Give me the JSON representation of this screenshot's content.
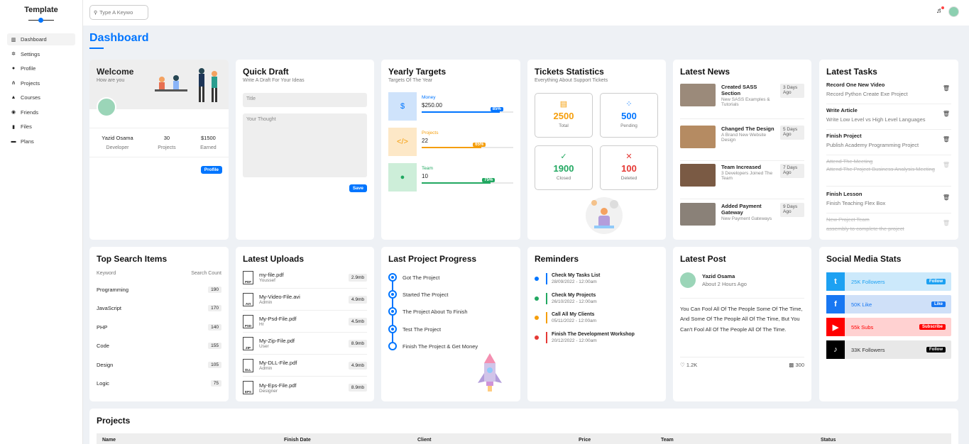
{
  "app": {
    "title": "Template"
  },
  "search": {
    "placeholder": "Type A Keywo"
  },
  "nav": [
    {
      "label": "Dashboard",
      "icon": "chart-icon"
    },
    {
      "label": "Settings",
      "icon": "gear-icon"
    },
    {
      "label": "Profile",
      "icon": "user-icon"
    },
    {
      "label": "Projects",
      "icon": "diagram-icon"
    },
    {
      "label": "Courses",
      "icon": "graduation-cap-icon"
    },
    {
      "label": "Friends",
      "icon": "user-circle-icon"
    },
    {
      "label": "Files",
      "icon": "file-icon"
    },
    {
      "label": "Plans",
      "icon": "credit-card-icon"
    }
  ],
  "page_title": "Dashboard",
  "welcome": {
    "title": "Welcome",
    "subtitle": "How are you",
    "name": "Yazid Osama",
    "role": "Developer",
    "projects_value": "30",
    "projects_label": "Projects",
    "earned_value": "$1500",
    "earned_label": "Earned",
    "button": "Profile"
  },
  "draft": {
    "title": "Quick Draft",
    "subtitle": "Write A Draft For Your Ideas",
    "title_placeholder": "Title",
    "body_placeholder": "Your Thought",
    "button": "Save"
  },
  "targets": {
    "title": "Yearly Targets",
    "subtitle": "Targets Of The Year",
    "items": [
      {
        "label": "Money",
        "value": "$250.00",
        "percent": "85%",
        "color": "#0075ff",
        "bg": "#cfe3fb",
        "glyph": "$"
      },
      {
        "label": "Projects",
        "value": "22",
        "percent": "65%",
        "color": "#f59e0b",
        "bg": "#fde8c7",
        "glyph": "</>"
      },
      {
        "label": "Team",
        "value": "10",
        "percent": "75%",
        "color": "#22a861",
        "bg": "#cdeed9",
        "glyph": "●"
      }
    ]
  },
  "tickets": {
    "title": "Tickets Statistics",
    "subtitle": "Everything About Support Tickets",
    "items": [
      {
        "value": "2500",
        "label": "Total",
        "color": "#f59e0b",
        "glyph": "▤"
      },
      {
        "value": "500",
        "label": "Pending",
        "color": "#0075ff",
        "glyph": "⁘"
      },
      {
        "value": "1900",
        "label": "Closed",
        "color": "#22a861",
        "glyph": "✓"
      },
      {
        "value": "100",
        "label": "Deleted",
        "color": "#e53935",
        "glyph": "✕"
      }
    ]
  },
  "news": {
    "title": "Latest News",
    "items": [
      {
        "title": "Created SASS Section",
        "sub": "New SASS Examples & Tutorials",
        "ago": "3 Days Ago"
      },
      {
        "title": "Changed The Design",
        "sub": "A Brand New Website Design",
        "ago": "5 Days Ago"
      },
      {
        "title": "Team Increased",
        "sub": "3 Developers Joined The Team",
        "ago": "7 Days Ago"
      },
      {
        "title": "Added Payment Gateway",
        "sub": "New Payment Gateways",
        "ago": "9 Days Ago"
      }
    ]
  },
  "tasks": {
    "title": "Latest Tasks",
    "items": [
      {
        "title": "Record One New Video",
        "desc": "Record Python Create Exe Project",
        "done": false
      },
      {
        "title": "Write Article",
        "desc": "Write Low Level vs High Level Languages",
        "done": false
      },
      {
        "title": "Finish Project",
        "desc": "Publish Academy Programming Project",
        "done": false
      },
      {
        "title": "Attend The Meeting",
        "desc": "Attend The Project Business Analysis Meeting",
        "done": true
      },
      {
        "title": "Finish Lesson",
        "desc": "Finish Teaching Flex Box",
        "done": false
      },
      {
        "title": "New Project Team",
        "desc": "assembly to complete the project",
        "done": true
      }
    ]
  },
  "top_search": {
    "title": "Top Search Items",
    "col1": "Keyword",
    "col2": "Search Count",
    "items": [
      {
        "keyword": "Programming",
        "count": "190"
      },
      {
        "keyword": "JavaScript",
        "count": "170"
      },
      {
        "keyword": "PHP",
        "count": "140"
      },
      {
        "keyword": "Code",
        "count": "155"
      },
      {
        "keyword": "Design",
        "count": "105"
      },
      {
        "keyword": "Logic",
        "count": "75"
      }
    ]
  },
  "uploads": {
    "title": "Latest Uploads",
    "items": [
      {
        "name": "my-file.pdf",
        "user": "Youssef",
        "size": "2.9mb",
        "ext": "PDF"
      },
      {
        "name": "My-Video-File.avi",
        "user": "Admin",
        "size": "4.9mb",
        "ext": "AVI"
      },
      {
        "name": "My-Psd-File.pdf",
        "user": "Hr",
        "size": "4.5mb",
        "ext": "PSD"
      },
      {
        "name": "My-Zip-File.pdf",
        "user": "User",
        "size": "8.9mb",
        "ext": "ZIP"
      },
      {
        "name": "My-DLL-File.pdf",
        "user": "Admin",
        "size": "4.9mb",
        "ext": "DLL"
      },
      {
        "name": "My-Eps-File.pdf",
        "user": "Designer",
        "size": "8.9mb",
        "ext": "EPS"
      }
    ]
  },
  "progress": {
    "title": "Last Project Progress",
    "steps": [
      {
        "label": "Got The Project",
        "done": true
      },
      {
        "label": "Started The Project",
        "done": true
      },
      {
        "label": "The Project About To Finish",
        "done": true
      },
      {
        "label": "Test The Project",
        "done": true
      },
      {
        "label": "Finish The Project & Get Money",
        "done": false
      }
    ]
  },
  "reminders": {
    "title": "Reminders",
    "items": [
      {
        "title": "Check My Tasks List",
        "date": "28/09/2022 - 12:00am",
        "color": "#0075ff"
      },
      {
        "title": "Check My Projects",
        "date": "26/10/2022 - 12:00am",
        "color": "#22a861"
      },
      {
        "title": "Call All My Clients",
        "date": "05/11/2022 - 12:00am",
        "color": "#f59e0b"
      },
      {
        "title": "Finish The Development Workshop",
        "date": "20/12/2022 - 12:00am",
        "color": "#e53935"
      }
    ]
  },
  "latest_post": {
    "title": "Latest Post",
    "author": "Yazid Osama",
    "time": "About 2 Hours Ago",
    "body": "You Can Fool All Of The People Some Of The Time, And Some Of The People All Of The Time, But You Can't Fool All Of The People All Of The Time.",
    "likes": "1.2K",
    "comments": "300"
  },
  "social": {
    "title": "Social Media Stats",
    "items": [
      {
        "text": "25K Followers",
        "button": "Follow",
        "color": "#1da1f2",
        "bg": "#cce9fb",
        "text_color": "#1da1f2",
        "glyph": "t"
      },
      {
        "text": "50K Like",
        "button": "Like",
        "color": "#1877f2",
        "bg": "#cfe0f8",
        "text_color": "#1877f2",
        "glyph": "f"
      },
      {
        "text": "55k Subs",
        "button": "Subscribe",
        "color": "#ff0000",
        "bg": "#ffd1d1",
        "text_color": "#ff0000",
        "glyph": "▶"
      },
      {
        "text": "33K Followers",
        "button": "Follow",
        "color": "#000000",
        "bg": "#e8e8e8",
        "text_color": "#333333",
        "glyph": "♪"
      }
    ]
  },
  "projects": {
    "title": "Projects",
    "headers": [
      "Name",
      "Finish Date",
      "Client",
      "Price",
      "Team",
      "Status"
    ]
  }
}
